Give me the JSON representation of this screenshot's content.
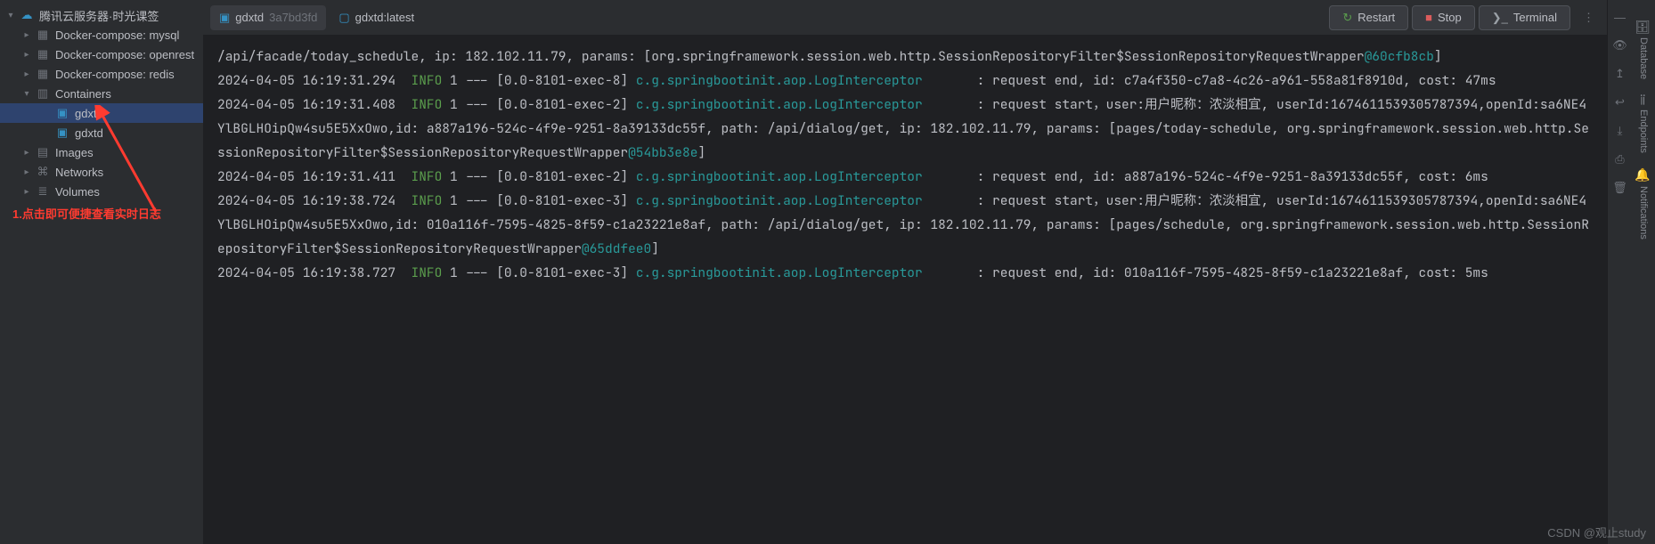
{
  "sidebar": {
    "root": {
      "label": "腾讯云服务器·时光课签"
    },
    "compose": [
      {
        "label": "Docker-compose: mysql"
      },
      {
        "label": "Docker-compose: openrest"
      },
      {
        "label": "Docker-compose: redis"
      }
    ],
    "containers_label": "Containers",
    "containers": [
      {
        "label": "gdxtd"
      },
      {
        "label": "gdxtd"
      }
    ],
    "images_label": "Images",
    "networks_label": "Networks",
    "volumes_label": "Volumes",
    "annotation": "1.点击即可便捷查看实时日志"
  },
  "tabs": {
    "t1": {
      "name": "gdxtd",
      "hash": "3a7bd3fd"
    },
    "t2": {
      "name": "gdxtd:latest"
    }
  },
  "buttons": {
    "restart": "Restart",
    "stop": "Stop",
    "terminal": "Terminal"
  },
  "console": {
    "lines": [
      {
        "pre": "/api/facade/today_schedule, ip: 182.102.11.79, params: [org.springframework.session.web.http.SessionRepositoryFilter$SessionRepositoryRequestWrapper",
        "ref": "@60cfb8cb",
        "post": "]"
      },
      {
        "ts": "2024-04-05 16:19:31.294  ",
        "lvl": "INFO",
        "mid": " 1 --- [0.0-8101-exec-8] ",
        "logger": "c.g.springbootinit.aop.LogInterceptor",
        "tail": "       : request end, id: c7a4f350-c7a8-4c26-a961-558a81f8910d, cost: 47ms"
      },
      {
        "ts": "2024-04-05 16:19:31.408  ",
        "lvl": "INFO",
        "mid": " 1 --- [0.0-8101-exec-2] ",
        "logger": "c.g.springbootinit.aop.LogInterceptor",
        "tail": "       : request start，user:用户昵称：浓淡相宜, userId:1674611539305787394,openId:sa6NE4YlBGLHOipQw4su5E5XxOwo,id: a887a196-524c-4f9e-9251-8a39133dc55f, path: /api/dialog/get, ip: 182.102.11.79, params: [pages/today-schedule, org.springframework.session.web.http.SessionRepositoryFilter$SessionRepositoryRequestWrapper",
        "ref": "@54bb3e8e",
        "post": "]"
      },
      {
        "ts": "2024-04-05 16:19:31.411  ",
        "lvl": "INFO",
        "mid": " 1 --- [0.0-8101-exec-2] ",
        "logger": "c.g.springbootinit.aop.LogInterceptor",
        "tail": "       : request end, id: a887a196-524c-4f9e-9251-8a39133dc55f, cost: 6ms"
      },
      {
        "ts": "2024-04-05 16:19:38.724  ",
        "lvl": "INFO",
        "mid": " 1 --- [0.0-8101-exec-3] ",
        "logger": "c.g.springbootinit.aop.LogInterceptor",
        "tail": "       : request start，user:用户昵称：浓淡相宜, userId:1674611539305787394,openId:sa6NE4YlBGLHOipQw4su5E5XxOwo,id: 010a116f-7595-4825-8f59-c1a23221e8af, path: /api/dialog/get, ip: 182.102.11.79, params: [pages/schedule, org.springframework.session.web.http.SessionRepositoryFilter$SessionRepositoryRequestWrapper",
        "ref": "@65ddfee0",
        "post": "]"
      },
      {
        "ts": "2024-04-05 16:19:38.727  ",
        "lvl": "INFO",
        "mid": " 1 --- [0.0-8101-exec-3] ",
        "logger": "c.g.springbootinit.aop.LogInterceptor",
        "tail": "       : request end, id: 010a116f-7595-4825-8f59-c1a23221e8af, cost: 5ms"
      }
    ]
  },
  "rails": {
    "database": "Database",
    "endpoints": "Endpoints",
    "notifications": "Notifications"
  },
  "watermark": "CSDN @观止study"
}
